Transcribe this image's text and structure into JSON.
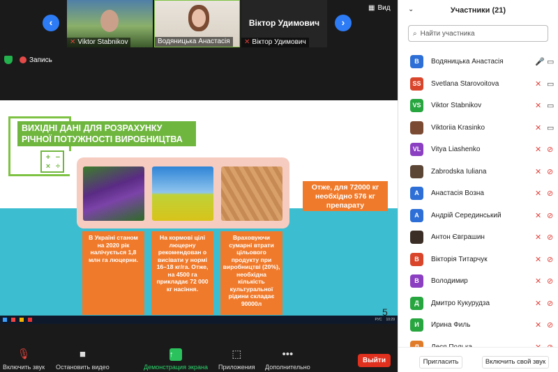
{
  "meeting": {
    "tiles": [
      {
        "name": "Viktor Stabnikov"
      },
      {
        "name": "Водяницька Анастасія"
      },
      {
        "name": "Віктор Удимович",
        "label_big": "Віктор Удимович"
      }
    ],
    "view_label": "Вид",
    "recording_label": "Запись"
  },
  "slide": {
    "title": "ВИХІДНІ ДАНІ ДЛЯ РОЗРАХУНКУ РІЧНОЇ ПОТУЖНОСТІ ВИРОБНИЦТВА",
    "boxes": [
      "В Україні станом на 2020 рік налічується 1,8 млн га люцерни.",
      "На кормові цілі люцерну рекомендован о висівати у нормі 16–18 кг/га. Отже, на 4500 га прикладає 72 000 кг насіння.",
      "Враховуючи сумарні втрати цільового продукту при виробництві (20%), необхідна кількість культуральної рідини складає 90000л"
    ],
    "side_note": "Отже, для 72000 кг необхідно 576 кг препарату",
    "page_number": "5",
    "taskbar_time": "10:29",
    "taskbar_lang": "РУС"
  },
  "toolbar": {
    "mute_label": "Включить звук",
    "video_label": "Остановить видео",
    "share_label": "Демонстрация экрана",
    "apps_label": "Приложения",
    "more_label": "Дополнительно",
    "leave_label": "Выйти"
  },
  "participants": {
    "title": "Участники (21)",
    "search_placeholder": "Найти участника",
    "list": [
      {
        "initials": "В",
        "name": "Водяницька Анастасія",
        "color": "#2d6fd6",
        "mic": "on",
        "cam": "on"
      },
      {
        "initials": "SS",
        "name": "Svetlana Starovoitova",
        "color": "#d9452b",
        "mic": "off",
        "cam": "on"
      },
      {
        "initials": "VS",
        "name": "Viktor Stabnikov",
        "color": "#27a53f",
        "mic": "off",
        "cam": "on"
      },
      {
        "initials": "",
        "name": "Viktoriia Krasinko",
        "color": "#7a4a32",
        "mic": "off",
        "cam": "on"
      },
      {
        "initials": "VL",
        "name": "Vitya Liashenko",
        "color": "#8b3fc1",
        "mic": "off",
        "cam": "off"
      },
      {
        "initials": "",
        "name": "Zabrodska Iuliana",
        "color": "#5b4636",
        "mic": "off",
        "cam": "off"
      },
      {
        "initials": "А",
        "name": "Анастасія Возна",
        "color": "#2d6fd6",
        "mic": "off",
        "cam": "off"
      },
      {
        "initials": "А",
        "name": "Андрій Серединський",
        "color": "#2d6fd6",
        "mic": "off",
        "cam": "off"
      },
      {
        "initials": "",
        "name": "Антон Євграшин",
        "color": "#3a2e26",
        "mic": "off",
        "cam": "off"
      },
      {
        "initials": "В",
        "name": "Вікторія Титарчук",
        "color": "#d9452b",
        "mic": "off",
        "cam": "off"
      },
      {
        "initials": "В",
        "name": "Володимир",
        "color": "#8b3fc1",
        "mic": "off",
        "cam": "off"
      },
      {
        "initials": "Д",
        "name": "Дмитро Кукурудза",
        "color": "#27a53f",
        "mic": "off",
        "cam": "off"
      },
      {
        "initials": "И",
        "name": "Ирина Филь",
        "color": "#27a53f",
        "mic": "off",
        "cam": "off"
      },
      {
        "initials": "Л",
        "name": "Леся Полька",
        "color": "#e07b2a",
        "mic": "off",
        "cam": "off"
      }
    ],
    "invite_label": "Пригласить",
    "unmute_label": "Включить свой звук"
  }
}
